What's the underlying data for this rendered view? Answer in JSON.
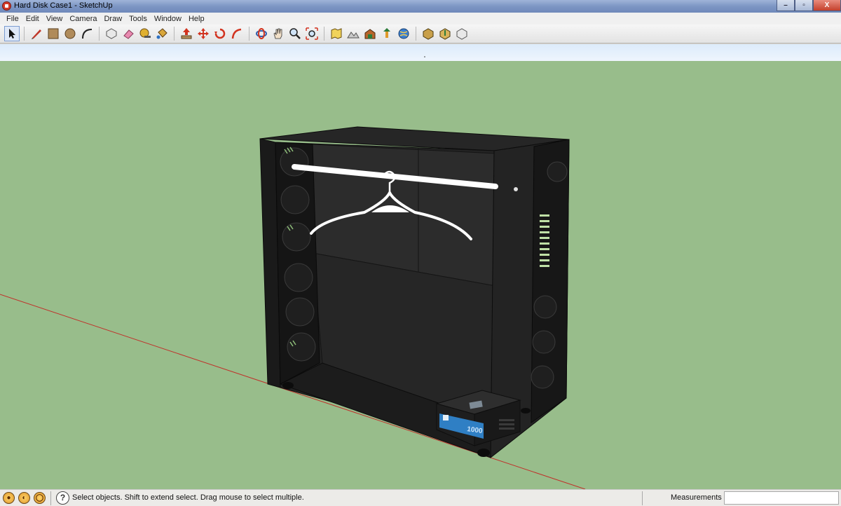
{
  "window": {
    "title": "Hard Disk Case1 - SketchUp",
    "controls": [
      "–",
      "▫",
      "X"
    ]
  },
  "menu": [
    "File",
    "Edit",
    "View",
    "Camera",
    "Draw",
    "Tools",
    "Window",
    "Help"
  ],
  "toolbar": {
    "tools": [
      {
        "name": "select-tool",
        "icon": "arrow-icon"
      },
      {
        "name": "line-tool",
        "icon": "pencil-icon"
      },
      {
        "name": "rectangle-tool",
        "icon": "rectangle-icon"
      },
      {
        "name": "circle-tool",
        "icon": "circle-icon"
      },
      {
        "name": "arc-tool",
        "icon": "arc-icon"
      },
      {
        "name": "make-component-tool",
        "icon": "component-icon"
      },
      {
        "name": "eraser-tool",
        "icon": "eraser-icon"
      },
      {
        "name": "tape-measure-tool",
        "icon": "tape-measure-icon"
      },
      {
        "name": "paint-bucket-tool",
        "icon": "paint-bucket-icon"
      },
      {
        "name": "push-pull-tool",
        "icon": "push-pull-icon"
      },
      {
        "name": "move-tool",
        "icon": "move-icon"
      },
      {
        "name": "rotate-tool",
        "icon": "rotate-icon"
      },
      {
        "name": "follow-me-tool",
        "icon": "follow-me-icon"
      },
      {
        "name": "orbit-tool",
        "icon": "orbit-icon"
      },
      {
        "name": "pan-tool",
        "icon": "hand-icon"
      },
      {
        "name": "zoom-tool",
        "icon": "magnifier-icon"
      },
      {
        "name": "zoom-extents-tool",
        "icon": "zoom-extents-icon"
      },
      {
        "name": "add-location-tool",
        "icon": "map-icon"
      },
      {
        "name": "toggle-terrain-tool",
        "icon": "terrain-icon"
      },
      {
        "name": "get-models-tool",
        "icon": "warehouse-icon"
      },
      {
        "name": "share-model-tool",
        "icon": "share-icon"
      },
      {
        "name": "preview-google-earth-tool",
        "icon": "globe-icon"
      },
      {
        "name": "get-components-tool",
        "icon": "get-components-icon"
      },
      {
        "name": "share-component-tool",
        "icon": "share-component-icon"
      },
      {
        "name": "extension-warehouse-tool",
        "icon": "extension-icon"
      }
    ]
  },
  "case_model": {
    "psu_label": "1000",
    "colors": {
      "ground": "#98bd8b",
      "sky": "#e7f2fd",
      "case_body": "#1e1e1e",
      "case_face": "#2b2b2b",
      "rod": "#ffffff",
      "psu_display": "#2f7fc4",
      "vent_green": "#bfe0a6",
      "red_axis": "#c0302a"
    }
  },
  "status": {
    "hint": "Select objects. Shift to extend select. Drag mouse to select multiple.",
    "measurements_label": "Measurements",
    "measurements_value": ""
  }
}
